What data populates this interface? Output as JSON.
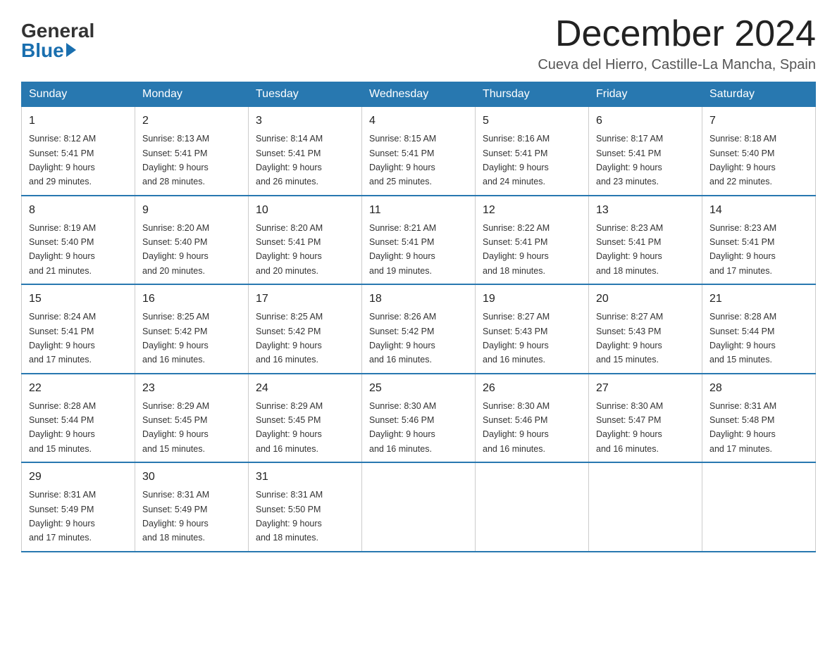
{
  "logo": {
    "general": "General",
    "blue": "Blue"
  },
  "title": "December 2024",
  "location": "Cueva del Hierro, Castille-La Mancha, Spain",
  "days_of_week": [
    "Sunday",
    "Monday",
    "Tuesday",
    "Wednesday",
    "Thursday",
    "Friday",
    "Saturday"
  ],
  "weeks": [
    [
      {
        "day": "1",
        "sunrise": "8:12 AM",
        "sunset": "5:41 PM",
        "daylight": "9 hours and 29 minutes."
      },
      {
        "day": "2",
        "sunrise": "8:13 AM",
        "sunset": "5:41 PM",
        "daylight": "9 hours and 28 minutes."
      },
      {
        "day": "3",
        "sunrise": "8:14 AM",
        "sunset": "5:41 PM",
        "daylight": "9 hours and 26 minutes."
      },
      {
        "day": "4",
        "sunrise": "8:15 AM",
        "sunset": "5:41 PM",
        "daylight": "9 hours and 25 minutes."
      },
      {
        "day": "5",
        "sunrise": "8:16 AM",
        "sunset": "5:41 PM",
        "daylight": "9 hours and 24 minutes."
      },
      {
        "day": "6",
        "sunrise": "8:17 AM",
        "sunset": "5:41 PM",
        "daylight": "9 hours and 23 minutes."
      },
      {
        "day": "7",
        "sunrise": "8:18 AM",
        "sunset": "5:40 PM",
        "daylight": "9 hours and 22 minutes."
      }
    ],
    [
      {
        "day": "8",
        "sunrise": "8:19 AM",
        "sunset": "5:40 PM",
        "daylight": "9 hours and 21 minutes."
      },
      {
        "day": "9",
        "sunrise": "8:20 AM",
        "sunset": "5:40 PM",
        "daylight": "9 hours and 20 minutes."
      },
      {
        "day": "10",
        "sunrise": "8:20 AM",
        "sunset": "5:41 PM",
        "daylight": "9 hours and 20 minutes."
      },
      {
        "day": "11",
        "sunrise": "8:21 AM",
        "sunset": "5:41 PM",
        "daylight": "9 hours and 19 minutes."
      },
      {
        "day": "12",
        "sunrise": "8:22 AM",
        "sunset": "5:41 PM",
        "daylight": "9 hours and 18 minutes."
      },
      {
        "day": "13",
        "sunrise": "8:23 AM",
        "sunset": "5:41 PM",
        "daylight": "9 hours and 18 minutes."
      },
      {
        "day": "14",
        "sunrise": "8:23 AM",
        "sunset": "5:41 PM",
        "daylight": "9 hours and 17 minutes."
      }
    ],
    [
      {
        "day": "15",
        "sunrise": "8:24 AM",
        "sunset": "5:41 PM",
        "daylight": "9 hours and 17 minutes."
      },
      {
        "day": "16",
        "sunrise": "8:25 AM",
        "sunset": "5:42 PM",
        "daylight": "9 hours and 16 minutes."
      },
      {
        "day": "17",
        "sunrise": "8:25 AM",
        "sunset": "5:42 PM",
        "daylight": "9 hours and 16 minutes."
      },
      {
        "day": "18",
        "sunrise": "8:26 AM",
        "sunset": "5:42 PM",
        "daylight": "9 hours and 16 minutes."
      },
      {
        "day": "19",
        "sunrise": "8:27 AM",
        "sunset": "5:43 PM",
        "daylight": "9 hours and 16 minutes."
      },
      {
        "day": "20",
        "sunrise": "8:27 AM",
        "sunset": "5:43 PM",
        "daylight": "9 hours and 15 minutes."
      },
      {
        "day": "21",
        "sunrise": "8:28 AM",
        "sunset": "5:44 PM",
        "daylight": "9 hours and 15 minutes."
      }
    ],
    [
      {
        "day": "22",
        "sunrise": "8:28 AM",
        "sunset": "5:44 PM",
        "daylight": "9 hours and 15 minutes."
      },
      {
        "day": "23",
        "sunrise": "8:29 AM",
        "sunset": "5:45 PM",
        "daylight": "9 hours and 15 minutes."
      },
      {
        "day": "24",
        "sunrise": "8:29 AM",
        "sunset": "5:45 PM",
        "daylight": "9 hours and 16 minutes."
      },
      {
        "day": "25",
        "sunrise": "8:30 AM",
        "sunset": "5:46 PM",
        "daylight": "9 hours and 16 minutes."
      },
      {
        "day": "26",
        "sunrise": "8:30 AM",
        "sunset": "5:46 PM",
        "daylight": "9 hours and 16 minutes."
      },
      {
        "day": "27",
        "sunrise": "8:30 AM",
        "sunset": "5:47 PM",
        "daylight": "9 hours and 16 minutes."
      },
      {
        "day": "28",
        "sunrise": "8:31 AM",
        "sunset": "5:48 PM",
        "daylight": "9 hours and 17 minutes."
      }
    ],
    [
      {
        "day": "29",
        "sunrise": "8:31 AM",
        "sunset": "5:49 PM",
        "daylight": "9 hours and 17 minutes."
      },
      {
        "day": "30",
        "sunrise": "8:31 AM",
        "sunset": "5:49 PM",
        "daylight": "9 hours and 18 minutes."
      },
      {
        "day": "31",
        "sunrise": "8:31 AM",
        "sunset": "5:50 PM",
        "daylight": "9 hours and 18 minutes."
      },
      null,
      null,
      null,
      null
    ]
  ],
  "labels": {
    "sunrise": "Sunrise:",
    "sunset": "Sunset:",
    "daylight": "Daylight:"
  }
}
